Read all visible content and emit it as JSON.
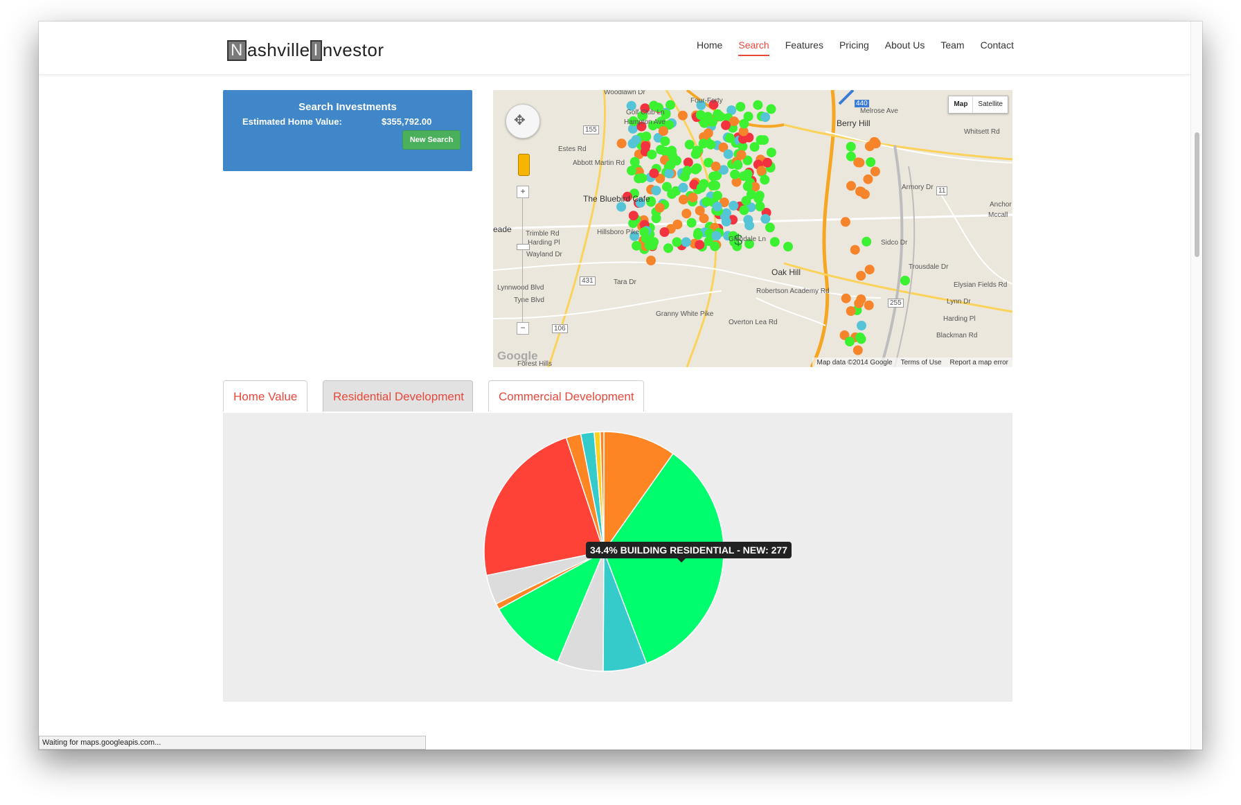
{
  "brand": {
    "logo_n": "N",
    "logo_part1": "ashville",
    "logo_i": "I",
    "logo_part2": "nvestor"
  },
  "nav": {
    "items": [
      {
        "label": "Home",
        "active": false
      },
      {
        "label": "Search",
        "active": true
      },
      {
        "label": "Features",
        "active": false
      },
      {
        "label": "Pricing",
        "active": false
      },
      {
        "label": "About Us",
        "active": false
      },
      {
        "label": "Team",
        "active": false
      },
      {
        "label": "Contact",
        "active": false
      }
    ]
  },
  "search": {
    "title": "Search Investments",
    "estimate_label": "Estimated Home Value:",
    "estimate_value": "$355,792.00",
    "new_search_label": "New Search"
  },
  "map": {
    "labels": [
      "Woodlawn Dr",
      "Golf Club Ln",
      "Hampton Ave",
      "Four-Forty",
      "Abbott Martin Rd",
      "Estes Rd",
      "The Bluebird Cafe",
      "Trimble Rd",
      "Harding Pl",
      "Wayland Dr",
      "Hillsboro Pike",
      "Lynnwood Blvd",
      "Tyne Blvd",
      "Tara Dr",
      "Granny White Pike",
      "Glendale Ln",
      "Oak Hill",
      "Robertson Academy Rd",
      "Overton Lea Rd",
      "Berry Hill",
      "Melrose Ave",
      "Whitsett Rd",
      "Elysian Fields Rd",
      "Lynn Dr",
      "Harding Pl",
      "Blackman Rd",
      "Mccall",
      "Anchor",
      "Sidco Dr",
      "Trousdale Dr",
      "Armory Dr",
      "Forest Hills",
      "eade",
      "155",
      "431",
      "106",
      "11",
      "255",
      "440"
    ],
    "type_map": "Map",
    "type_satellite": "Satellite",
    "google": "Google",
    "footer_data": "Map data ©2014 Google",
    "footer_terms": "Terms of Use",
    "footer_report": "Report a map error",
    "marker_colors": {
      "red": "#f2323f",
      "orange": "#f5842b",
      "green": "#3cf032",
      "cyan": "#55c4d6"
    }
  },
  "tabs": [
    {
      "label": "Home Value",
      "active": false
    },
    {
      "label": "Residential Development",
      "active": true
    },
    {
      "label": "Commercial Development",
      "active": false
    }
  ],
  "chart_data": {
    "type": "pie",
    "slices": [
      {
        "value": 9.8,
        "color": "#fd8523"
      },
      {
        "value": 34.4,
        "color": "#00fd6e",
        "label": "BUILDING RESIDENTIAL - NEW",
        "count": 277
      },
      {
        "value": 5.9,
        "color": "#35cbcb"
      },
      {
        "value": 6.2,
        "color": "#dcdcdc"
      },
      {
        "value": 10.7,
        "color": "#00fd6e"
      },
      {
        "value": 0.8,
        "color": "#fd8523"
      },
      {
        "value": 4.0,
        "color": "#dcdcdc"
      },
      {
        "value": 23.1,
        "color": "#fe4238"
      },
      {
        "value": 2.0,
        "color": "#fd8523"
      },
      {
        "value": 1.8,
        "color": "#35cbcb"
      },
      {
        "value": 0.8,
        "color": "#fdd020"
      },
      {
        "value": 0.5,
        "color": "#fd8523"
      }
    ],
    "tooltip": "34.4% BUILDING RESIDENTIAL - NEW: 277"
  },
  "status": {
    "text": "Waiting for maps.googleapis.com..."
  }
}
